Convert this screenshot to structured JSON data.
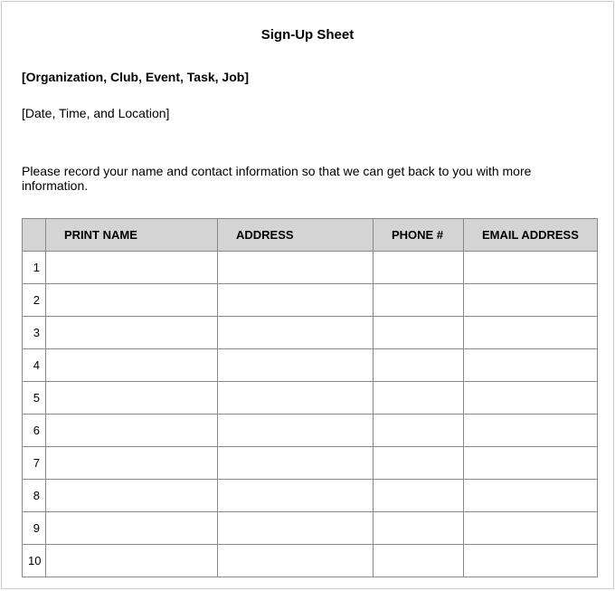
{
  "title": "Sign-Up Sheet",
  "org_line": "[Organization, Club, Event, Task, Job]",
  "date_line": "[Date, Time, and Location]",
  "instructions": "Please record your name and contact information so that we can get back to you with more information.",
  "columns": {
    "num": "",
    "name": "PRINT NAME",
    "address": "ADDRESS",
    "phone": "PHONE #",
    "email": "EMAIL ADDRESS"
  },
  "rows": [
    {
      "num": "1",
      "name": "",
      "address": "",
      "phone": "",
      "email": ""
    },
    {
      "num": "2",
      "name": "",
      "address": "",
      "phone": "",
      "email": ""
    },
    {
      "num": "3",
      "name": "",
      "address": "",
      "phone": "",
      "email": ""
    },
    {
      "num": "4",
      "name": "",
      "address": "",
      "phone": "",
      "email": ""
    },
    {
      "num": "5",
      "name": "",
      "address": "",
      "phone": "",
      "email": ""
    },
    {
      "num": "6",
      "name": "",
      "address": "",
      "phone": "",
      "email": ""
    },
    {
      "num": "7",
      "name": "",
      "address": "",
      "phone": "",
      "email": ""
    },
    {
      "num": "8",
      "name": "",
      "address": "",
      "phone": "",
      "email": ""
    },
    {
      "num": "9",
      "name": "",
      "address": "",
      "phone": "",
      "email": ""
    },
    {
      "num": "10",
      "name": "",
      "address": "",
      "phone": "",
      "email": ""
    }
  ]
}
